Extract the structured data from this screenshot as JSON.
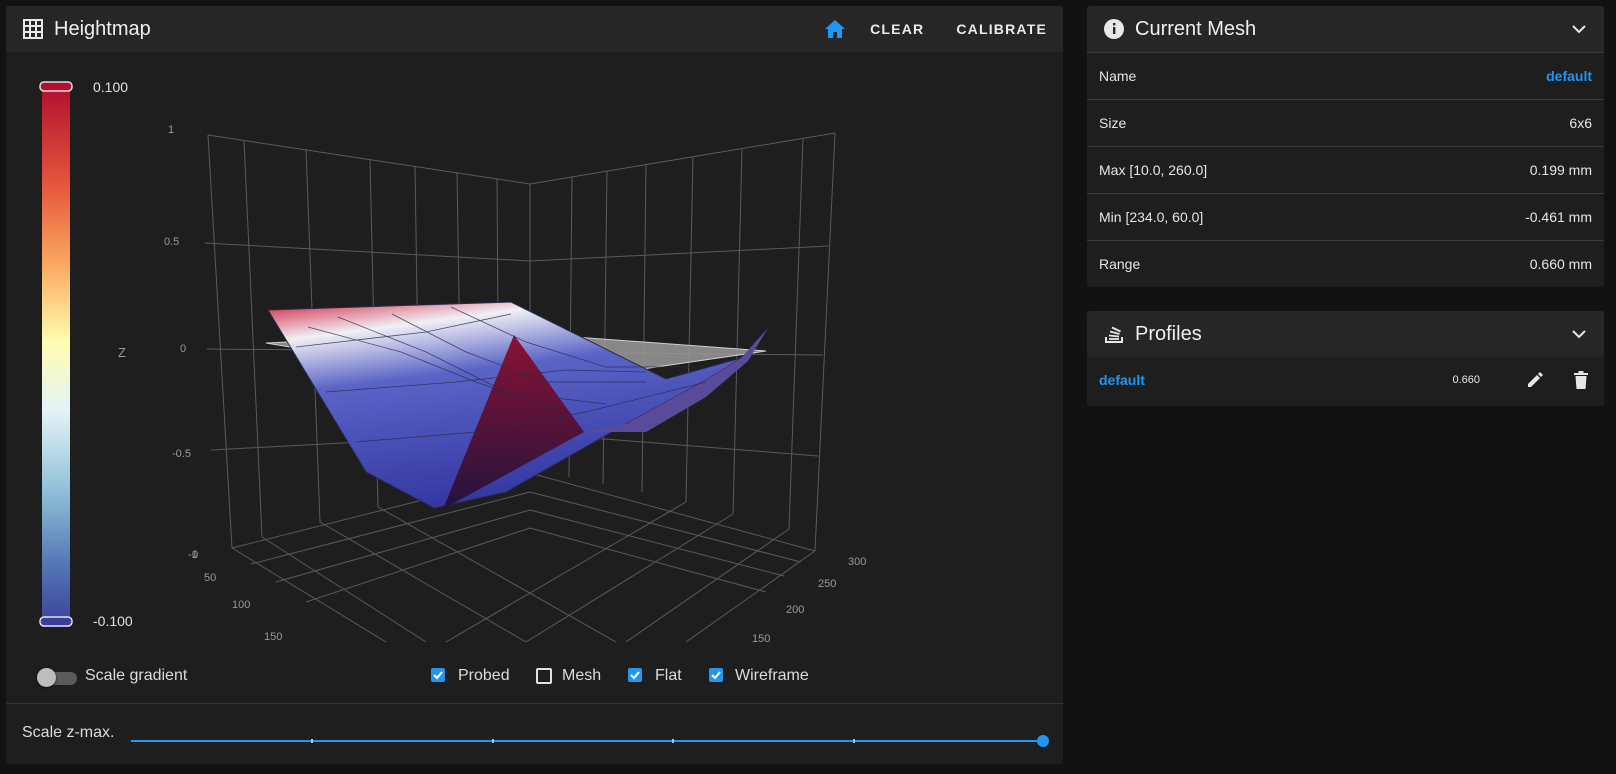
{
  "heightmap": {
    "title": "Heightmap",
    "actions": {
      "home_icon": "home-icon",
      "clear_label": "CLEAR",
      "calibrate_label": "CALIBRATE"
    },
    "colors": {
      "accent": "#2196f3",
      "scale_top": "#b2102e",
      "scale_mid": "#fffdb0",
      "scale_bottom": "#3a3f9c"
    },
    "colorscale": {
      "max_label": "0.100",
      "min_label": "-0.100"
    },
    "axes": {
      "z_title": "Z",
      "z_ticks": [
        "1",
        "0.5",
        "0",
        "-0.5",
        "-1"
      ],
      "x_ticks": [
        "0",
        "50",
        "100",
        "150"
      ],
      "y_ticks": [
        "300",
        "250",
        "200",
        "150"
      ]
    },
    "chart_data": {
      "type": "surface",
      "title": "",
      "zlabel": "Z",
      "zlim": [
        -1,
        1
      ],
      "colorscale_range": [
        -0.1,
        0.1
      ],
      "grid": true,
      "mesh_size": "6x6",
      "z_max": 0.199,
      "z_max_at": [
        10.0,
        260.0
      ],
      "z_min": -0.461,
      "z_min_at": [
        234.0,
        60.0
      ],
      "series": [
        {
          "name": "Probed",
          "shown": true
        },
        {
          "name": "Mesh",
          "shown": false
        },
        {
          "name": "Flat",
          "shown": true
        },
        {
          "name": "Wireframe",
          "shown": true
        }
      ]
    },
    "options": {
      "scale_gradient_label": "Scale gradient",
      "scale_gradient_on": false,
      "checkboxes": [
        {
          "label": "Probed",
          "checked": true
        },
        {
          "label": "Mesh",
          "checked": false
        },
        {
          "label": "Flat",
          "checked": true
        },
        {
          "label": "Wireframe",
          "checked": true
        }
      ]
    },
    "slider": {
      "label": "Scale z-max.",
      "value_fraction": 1.0
    }
  },
  "current_mesh": {
    "title": "Current Mesh",
    "rows": [
      {
        "label": "Name",
        "value": "default"
      },
      {
        "label": "Size",
        "value": "6x6"
      },
      {
        "label": "Max [10.0, 260.0]",
        "value": "0.199 mm"
      },
      {
        "label": "Min [234.0, 60.0]",
        "value": "-0.461 mm"
      },
      {
        "label": "Range",
        "value": "0.660 mm"
      }
    ]
  },
  "profiles": {
    "title": "Profiles",
    "items": [
      {
        "name": "default",
        "range": "0.660"
      }
    ]
  }
}
